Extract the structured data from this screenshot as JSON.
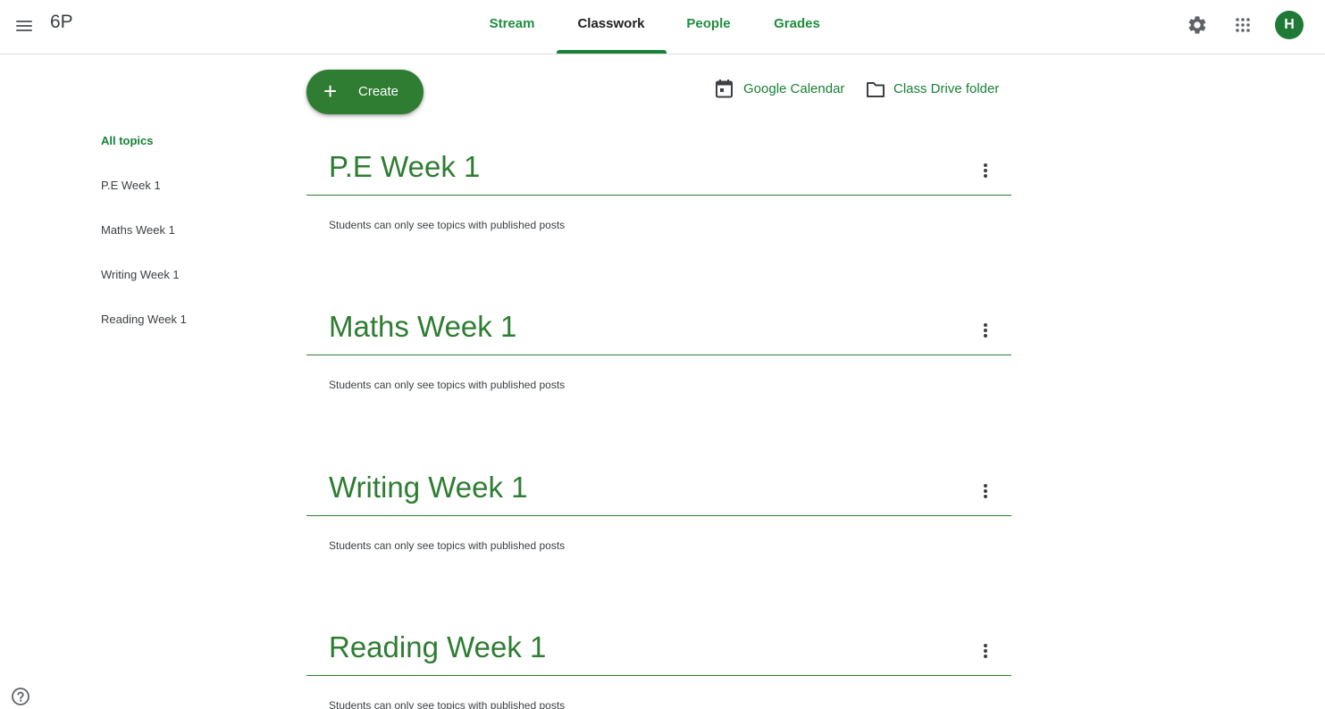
{
  "header": {
    "class_name": "6P",
    "tabs": [
      {
        "label": "Stream",
        "active": false
      },
      {
        "label": "Classwork",
        "active": true
      },
      {
        "label": "People",
        "active": false
      },
      {
        "label": "Grades",
        "active": false
      }
    ],
    "icons": [
      "menu-icon",
      "settings-icon",
      "apps-icon"
    ],
    "avatar_initial": "H"
  },
  "toolbar": {
    "create_label": "Create",
    "create_icon": "plus-icon",
    "calendar_label": "Google Calendar",
    "calendar_icon": "calendar-icon",
    "drive_label": "Class Drive folder",
    "drive_icon": "folder-icon"
  },
  "sidebar": {
    "items": [
      {
        "label": "All topics",
        "active": true
      },
      {
        "label": "P.E Week 1",
        "active": false
      },
      {
        "label": "Maths Week 1",
        "active": false
      },
      {
        "label": "Writing Week 1",
        "active": false
      },
      {
        "label": "Reading Week 1",
        "active": false
      }
    ]
  },
  "topics": [
    {
      "title": "P.E Week 1",
      "note": "Students can only see topics with published posts"
    },
    {
      "title": "Maths Week 1",
      "note": "Students can only see topics with published posts"
    },
    {
      "title": "Writing Week 1",
      "note": "Students can only see topics with published posts"
    },
    {
      "title": "Reading Week 1",
      "note": "Students can only see topics with published posts"
    }
  ],
  "footer": {
    "help_icon": "help-icon"
  },
  "colors": {
    "accent": "#188038",
    "heading": "#2e7d32",
    "avatar": "#1e7a34",
    "text": "#3c4043"
  }
}
